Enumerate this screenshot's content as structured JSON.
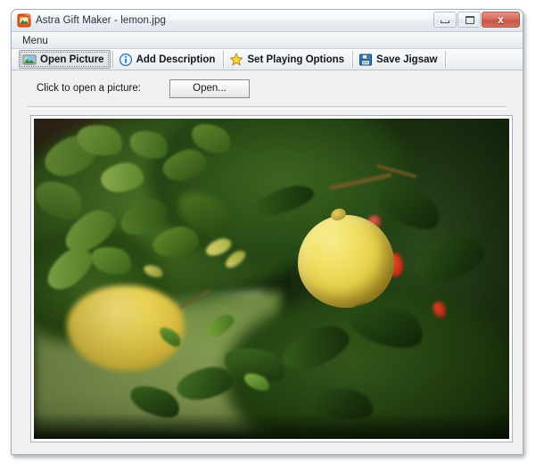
{
  "window": {
    "title": "Astra Gift Maker - lemon.jpg",
    "app_icon": "picture-app-icon",
    "controls": {
      "minimize": "–",
      "maximize": "□",
      "close": "x"
    }
  },
  "menubar": {
    "items": [
      {
        "label": "Menu",
        "name": "menu-item-menu"
      }
    ]
  },
  "toolbar": {
    "buttons": [
      {
        "label": "Open Picture",
        "icon": "picture-icon",
        "name": "toolbar-open-picture",
        "selected": true
      },
      {
        "label": "Add Description",
        "icon": "info-icon",
        "name": "toolbar-add-description",
        "selected": false
      },
      {
        "label": "Set Playing Options",
        "icon": "star-icon",
        "name": "toolbar-set-playing-options",
        "selected": false
      },
      {
        "label": "Save Jigsaw",
        "icon": "save-icon",
        "name": "toolbar-save-jigsaw",
        "selected": false
      }
    ]
  },
  "main": {
    "open_label": "Click to open a picture:",
    "open_button": "Open...",
    "picture": {
      "alt": "Lemons on a lemon tree with green foliage",
      "file_name": "lemon.jpg"
    }
  },
  "colors": {
    "window_frame": "#9eb0c4",
    "titlebar_top": "#fdfdfd",
    "titlebar_bottom": "#e2e8ee",
    "close_button": "#c85546",
    "client_bg": "#f0f0f0",
    "lemon_yellow": "#e8d14a",
    "foliage_green": "#2c4a1c",
    "grass_green": "#7f9850",
    "path_gray": "#a3a6a1",
    "flower_red": "#cc2a16"
  }
}
